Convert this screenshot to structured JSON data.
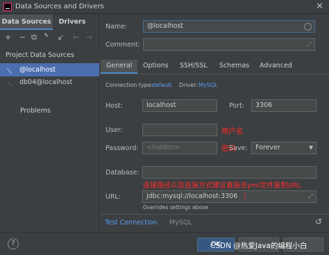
{
  "window": {
    "title": "Data Sources and Drivers",
    "close": "✕"
  },
  "left": {
    "tabs": [
      "Data Sources",
      "Drivers"
    ],
    "toolbar": [
      "+",
      "−",
      "⧉",
      "🔧",
      "↙",
      "←",
      "→"
    ],
    "section": "Project Data Sources",
    "items": [
      "@localhost",
      "db04@localhost"
    ],
    "problems": "Problems"
  },
  "form": {
    "name_label": "Name:",
    "name_value": "@localhost",
    "comment_label": "Comment:",
    "tabs": [
      "General",
      "Options",
      "SSH/SSL",
      "Schemas",
      "Advanced"
    ],
    "connection_type_label": "Connection type:",
    "connection_type_value": "default",
    "driver_label": "Driver:",
    "driver_value": "MySQL",
    "host_label": "Host:",
    "host_value": "localhost",
    "port_label": "Port:",
    "port_value": "3306",
    "user_label": "User:",
    "password_label": "Password:",
    "password_placeholder": "<hidden>",
    "save_label": "Save:",
    "save_value": "Forever",
    "database_label": "Database:",
    "url_label": "URL:",
    "url_value": "jdbc:mysql://localhost:3306",
    "url_hint": "Overrides settings above",
    "test_connection": "Test Connection",
    "test_driver": "MySQL"
  },
  "annotations": {
    "username": "用户名",
    "password": "密码",
    "url_note": "连接路径以及连接方式建议直接去yml文件复制URL"
  },
  "footer": {
    "help": "?",
    "ok": "OK",
    "watermark": "CSDN @热爱Java的编程小白"
  },
  "colors": {
    "accent": "#4a88c7",
    "selection": "#4b6eaf",
    "annotation": "#ff2a2a",
    "link": "#589df6"
  }
}
